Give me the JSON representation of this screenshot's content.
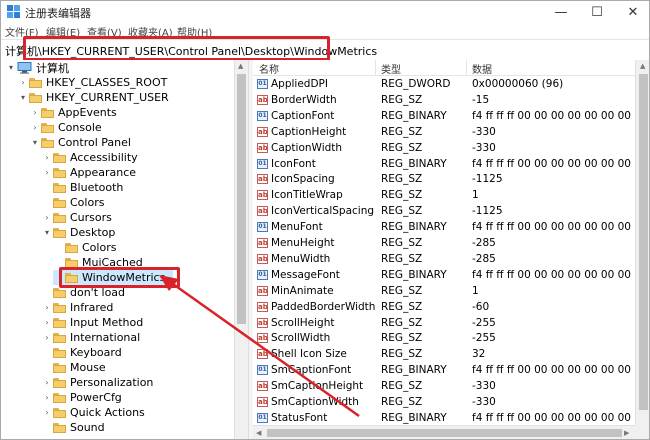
{
  "window": {
    "title": "注册表编辑器",
    "controls": {
      "minimize": "—",
      "maximize": "☐",
      "close": "✕"
    }
  },
  "menu": [
    "文件(F)",
    "编辑(E)",
    "查看(V)",
    "收藏夹(A)",
    "帮助(H)"
  ],
  "address": "计算机\\HKEY_CURRENT_USER\\Control Panel\\Desktop\\WindowMetrics",
  "tree": [
    {
      "label": "计算机",
      "icon": "computer-icon",
      "expander": "▾"
    },
    {
      "label": "HKEY_CLASSES_ROOT",
      "icon": "folder-icon",
      "expander": "›"
    },
    {
      "label": "HKEY_CURRENT_USER",
      "icon": "folder-icon",
      "expander": "▾"
    },
    {
      "label": "AppEvents",
      "icon": "folder-icon",
      "expander": "›"
    },
    {
      "label": "Console",
      "icon": "folder-icon",
      "expander": "›"
    },
    {
      "label": "Control Panel",
      "icon": "folder-icon",
      "expander": "▾"
    },
    {
      "label": "Accessibility",
      "icon": "folder-icon",
      "expander": "›"
    },
    {
      "label": "Appearance",
      "icon": "folder-icon",
      "expander": "›"
    },
    {
      "label": "Bluetooth",
      "icon": "folder-icon",
      "expander": ""
    },
    {
      "label": "Colors",
      "icon": "folder-icon",
      "expander": ""
    },
    {
      "label": "Cursors",
      "icon": "folder-icon",
      "expander": "›"
    },
    {
      "label": "Desktop",
      "icon": "folder-icon",
      "expander": "▾"
    },
    {
      "label": "Colors",
      "icon": "folder-icon",
      "expander": ""
    },
    {
      "label": "MuiCached",
      "icon": "folder-icon",
      "expander": ""
    },
    {
      "label": "WindowMetrics",
      "icon": "folder-icon",
      "expander": "",
      "selected": true
    },
    {
      "label": "don't load",
      "icon": "folder-icon",
      "expander": ""
    },
    {
      "label": "Infrared",
      "icon": "folder-icon",
      "expander": "›"
    },
    {
      "label": "Input Method",
      "icon": "folder-icon",
      "expander": "›"
    },
    {
      "label": "International",
      "icon": "folder-icon",
      "expander": "›"
    },
    {
      "label": "Keyboard",
      "icon": "folder-icon",
      "expander": ""
    },
    {
      "label": "Mouse",
      "icon": "folder-icon",
      "expander": ""
    },
    {
      "label": "Personalization",
      "icon": "folder-icon",
      "expander": "›"
    },
    {
      "label": "PowerCfg",
      "icon": "folder-icon",
      "expander": "›"
    },
    {
      "label": "Quick Actions",
      "icon": "folder-icon",
      "expander": "›"
    },
    {
      "label": "Sound",
      "icon": "folder-icon",
      "expander": ""
    }
  ],
  "list": {
    "headers": {
      "name": "名称",
      "type": "类型",
      "data": "数据"
    },
    "rows": [
      {
        "name": "AppliedDPI",
        "type": "REG_DWORD",
        "data": "0x00000060 (96)",
        "icon": "bin"
      },
      {
        "name": "BorderWidth",
        "type": "REG_SZ",
        "data": "-15",
        "icon": "sz"
      },
      {
        "name": "CaptionFont",
        "type": "REG_BINARY",
        "data": "f4 ff ff ff 00 00 00 00 00 00 00 00 00 00 00 0",
        "icon": "bin"
      },
      {
        "name": "CaptionHeight",
        "type": "REG_SZ",
        "data": "-330",
        "icon": "sz"
      },
      {
        "name": "CaptionWidth",
        "type": "REG_SZ",
        "data": "-330",
        "icon": "sz"
      },
      {
        "name": "IconFont",
        "type": "REG_BINARY",
        "data": "f4 ff ff ff 00 00 00 00 00 00 00 00 00 00 00 0",
        "icon": "bin"
      },
      {
        "name": "IconSpacing",
        "type": "REG_SZ",
        "data": "-1125",
        "icon": "sz"
      },
      {
        "name": "IconTitleWrap",
        "type": "REG_SZ",
        "data": "1",
        "icon": "sz"
      },
      {
        "name": "IconVerticalSpacing",
        "type": "REG_SZ",
        "data": "-1125",
        "icon": "sz"
      },
      {
        "name": "MenuFont",
        "type": "REG_BINARY",
        "data": "f4 ff ff ff 00 00 00 00 00 00 00 00 00 00 00 0",
        "icon": "bin"
      },
      {
        "name": "MenuHeight",
        "type": "REG_SZ",
        "data": "-285",
        "icon": "sz"
      },
      {
        "name": "MenuWidth",
        "type": "REG_SZ",
        "data": "-285",
        "icon": "sz"
      },
      {
        "name": "MessageFont",
        "type": "REG_BINARY",
        "data": "f4 ff ff ff 00 00 00 00 00 00 00 00 00 00 00 0",
        "icon": "bin"
      },
      {
        "name": "MinAnimate",
        "type": "REG_SZ",
        "data": "1",
        "icon": "sz"
      },
      {
        "name": "PaddedBorderWidth",
        "type": "REG_SZ",
        "data": "-60",
        "icon": "sz"
      },
      {
        "name": "ScrollHeight",
        "type": "REG_SZ",
        "data": "-255",
        "icon": "sz"
      },
      {
        "name": "ScrollWidth",
        "type": "REG_SZ",
        "data": "-255",
        "icon": "sz"
      },
      {
        "name": "Shell Icon Size",
        "type": "REG_SZ",
        "data": "32",
        "icon": "sz"
      },
      {
        "name": "SmCaptionFont",
        "type": "REG_BINARY",
        "data": "f4 ff ff ff 00 00 00 00 00 00 00 00 00 00 00 0",
        "icon": "bin"
      },
      {
        "name": "SmCaptionHeight",
        "type": "REG_SZ",
        "data": "-330",
        "icon": "sz"
      },
      {
        "name": "SmCaptionWidth",
        "type": "REG_SZ",
        "data": "-330",
        "icon": "sz"
      },
      {
        "name": "StatusFont",
        "type": "REG_BINARY",
        "data": "f4 ff ff ff 00 00 00 00 00 00 00 00 00 00 00 0",
        "icon": "bin"
      }
    ]
  },
  "icon_labels": {
    "sz": "ab",
    "bin": "01"
  },
  "colors": {
    "annotation": "#d9232a",
    "selection": "#cce8ff"
  }
}
